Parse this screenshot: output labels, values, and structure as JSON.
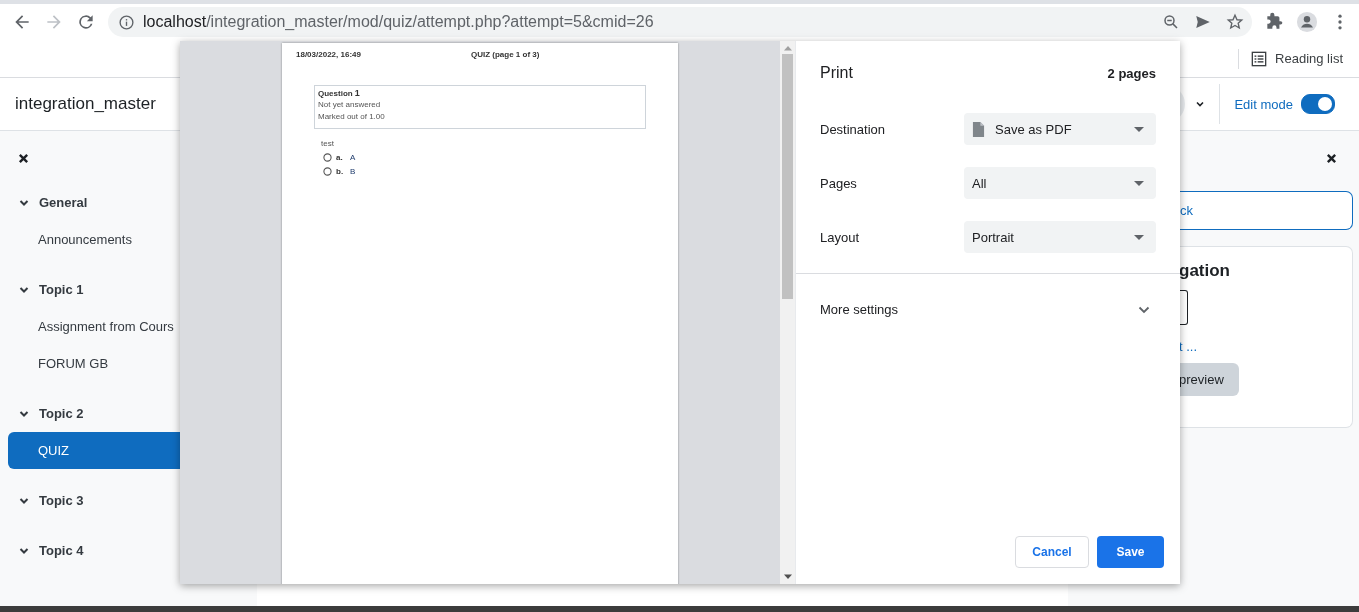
{
  "browser": {
    "url": {
      "host": "localhost",
      "path": "/integration_master/mod/quiz/attempt.php?attempt=5&cmid=26"
    },
    "forward_disabled": true,
    "reading_list": "Reading list"
  },
  "header": {
    "site_name": "integration_master",
    "edit_mode": {
      "label": "Edit mode",
      "on": true
    }
  },
  "course_index": {
    "sections": [
      {
        "label": "General",
        "expanded": true,
        "children": [
          {
            "label": "Announcements",
            "selected": false
          }
        ]
      },
      {
        "label": "Topic 1",
        "expanded": true,
        "children": [
          {
            "label": "Assignment from Cours",
            "selected": false
          },
          {
            "label": "FORUM GB",
            "selected": false
          }
        ]
      },
      {
        "label": "Topic 2",
        "expanded": true,
        "children": [
          {
            "label": "QUIZ",
            "selected": true
          }
        ]
      },
      {
        "label": "Topic 3",
        "expanded": true
      },
      {
        "label": "Topic 4",
        "expanded": true
      }
    ]
  },
  "drawer": {
    "back_button": "ck",
    "card_title": "gation",
    "link": "t ...",
    "preview_button": "preview"
  },
  "print_dialog": {
    "preview": {
      "date": "18/03/2022, 16:49",
      "page_title": "QUIZ (page 1 of 3)",
      "question_label": "Question",
      "question_number": "1",
      "status": "Not yet answered",
      "mark": "Marked out of 1.00",
      "question_text": "test",
      "options": [
        {
          "letter": "a.",
          "text": "A",
          "selected": false
        },
        {
          "letter": "b.",
          "text": "B",
          "selected": false
        }
      ]
    },
    "title": "Print",
    "page_count": "2 pages",
    "settings": [
      {
        "kind": "destination",
        "label": "Destination",
        "value": "Save as PDF"
      },
      {
        "kind": "select",
        "label": "Pages",
        "value": "All"
      },
      {
        "kind": "select",
        "label": "Layout",
        "value": "Portrait"
      }
    ],
    "more_settings": {
      "label": "More settings",
      "expanded": false
    },
    "buttons": [
      {
        "kind": "secondary",
        "label": "Cancel"
      },
      {
        "kind": "primary",
        "label": "Save"
      }
    ]
  }
}
